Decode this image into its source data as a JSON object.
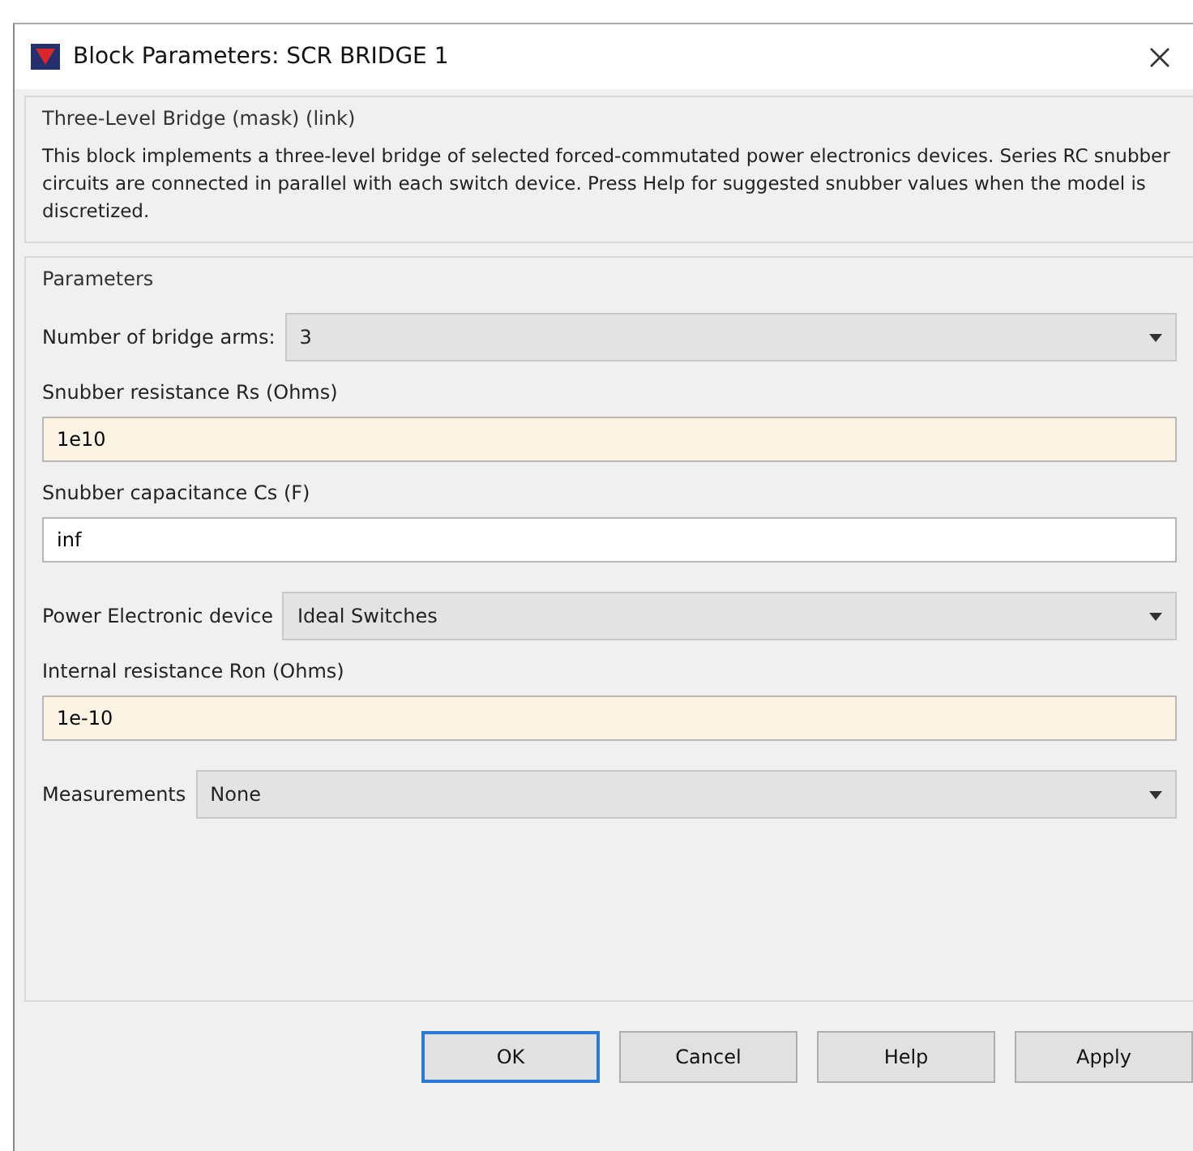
{
  "window": {
    "title": "Block Parameters: SCR BRIDGE 1"
  },
  "description": {
    "heading": "Three-Level Bridge (mask) (link)",
    "text": "This block implements a three-level bridge of selected forced-commutated power electronics devices.  Series RC snubber circuits are connected in parallel with each switch device.  Press Help for suggested snubber values when the model is discretized."
  },
  "parameters": {
    "heading": "Parameters",
    "items": [
      {
        "kind": "dropdown",
        "label": "Number of bridge arms:",
        "value": "3"
      },
      {
        "kind": "field",
        "label": "Snubber resistance Rs (Ohms)",
        "value": "1e10",
        "highlighted": true
      },
      {
        "kind": "field",
        "label": "Snubber capacitance Cs (F)",
        "value": "inf",
        "highlighted": false
      },
      {
        "kind": "dropdown",
        "label": "Power Electronic device",
        "value": "Ideal Switches"
      },
      {
        "kind": "field",
        "label": "Internal resistance Ron (Ohms)",
        "value": "1e-10",
        "highlighted": true
      },
      {
        "kind": "dropdown",
        "label": "Measurements",
        "value": "None"
      }
    ]
  },
  "buttons": [
    {
      "label": "OK",
      "default": true
    },
    {
      "label": "Cancel",
      "default": false
    },
    {
      "label": "Help",
      "default": false
    },
    {
      "label": "Apply",
      "default": false
    }
  ]
}
